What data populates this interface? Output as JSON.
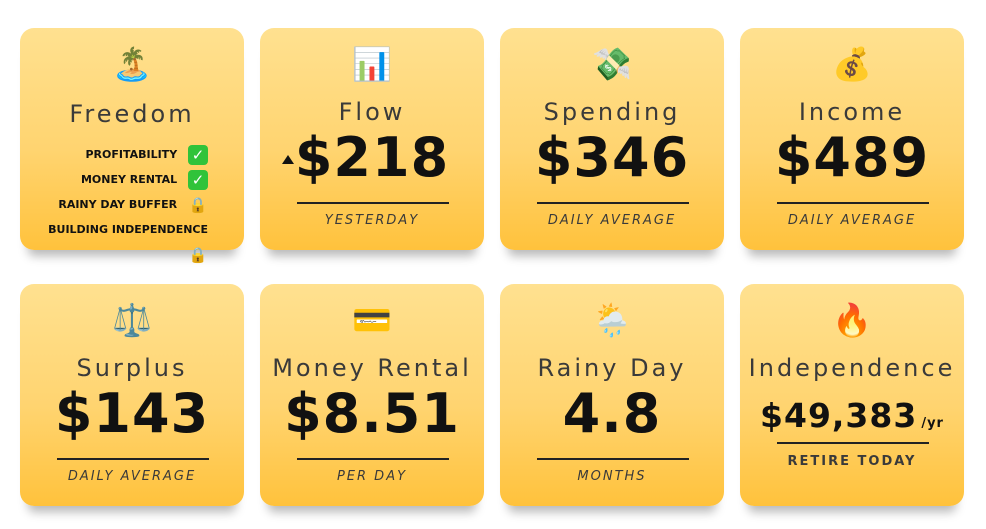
{
  "cards": {
    "freedom": {
      "icon": "🏝️",
      "title": "Freedom",
      "items": [
        {
          "label": "PROFITABILITY",
          "status_icon": "✅"
        },
        {
          "label": "MONEY RENTAL",
          "status_icon": "✅"
        },
        {
          "label": "RAINY DAY BUFFER",
          "status_icon": "🔒"
        },
        {
          "label": "BUILDING INDEPENDENCE",
          "status_icon": "🔒"
        }
      ]
    },
    "flow": {
      "icon": "📊",
      "title": "Flow",
      "value": "$218",
      "caption": "YESTERDAY",
      "trend": "up"
    },
    "spending": {
      "icon": "💸",
      "title": "Spending",
      "value": "$346",
      "caption": "DAILY AVERAGE"
    },
    "income": {
      "icon": "💰",
      "title": "Income",
      "value": "$489",
      "caption": "DAILY AVERAGE"
    },
    "surplus": {
      "icon": "⚖️",
      "title": "Surplus",
      "value": "$143",
      "caption": "DAILY AVERAGE"
    },
    "money_rental": {
      "icon": "💳",
      "title": "Money Rental",
      "value": "$8.51",
      "caption": "PER DAY"
    },
    "rainy_day": {
      "icon": "🌦️",
      "title": "Rainy Day",
      "value": "4.8",
      "caption": "MONTHS"
    },
    "independence": {
      "icon": "🔥",
      "title": "Independence",
      "value": "$49,383",
      "unit": "/yr",
      "caption": "RETIRE TODAY"
    }
  },
  "colors": {
    "card_top": "#ffe190",
    "card_bottom": "#ffc23c",
    "check_green": "#30c33a"
  }
}
